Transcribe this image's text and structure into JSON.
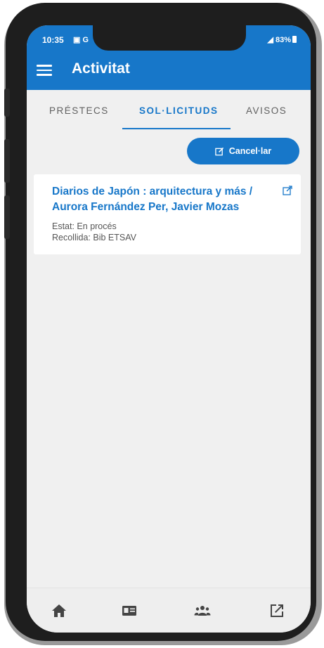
{
  "status_bar": {
    "time": "10:35",
    "left_icons": "▣ G",
    "battery": "83%"
  },
  "app_bar": {
    "title": "Activitat",
    "menu_icon": "hamburger-menu-icon"
  },
  "tabs": [
    {
      "label": "PRÉSTECS",
      "active": false
    },
    {
      "label": "SOL·LICITUDS",
      "active": true
    },
    {
      "label": "AVISOS",
      "active": false
    }
  ],
  "actions": {
    "cancel_label": "Cancel·lar",
    "cancel_icon": "edit-icon"
  },
  "request": {
    "title": "Diarios de Japón : arquitectura y más / Aurora Fernández Per, Javier Mozas",
    "status": "Estat: En procés",
    "pickup": "Recollida: Bib ETSAV",
    "open_icon": "external-link-icon"
  },
  "bottom_nav": [
    {
      "icon": "home-icon"
    },
    {
      "icon": "id-card-icon"
    },
    {
      "icon": "people-group-icon"
    },
    {
      "icon": "external-link-icon"
    }
  ],
  "colors": {
    "primary": "#1777c9",
    "background": "#f0f0f0",
    "card": "#ffffff"
  }
}
